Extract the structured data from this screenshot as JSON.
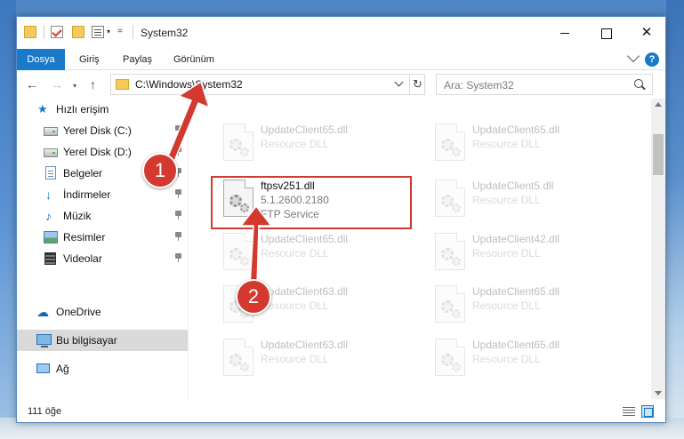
{
  "window": {
    "title": "System32",
    "quick_access": {
      "menu_glyph": "="
    },
    "controls": {
      "minimize": "",
      "maximize": "",
      "close": "✕"
    }
  },
  "ribbon": {
    "tabs": [
      {
        "label": "Dosya",
        "active": true
      },
      {
        "label": "Giriş"
      },
      {
        "label": "Paylaş"
      },
      {
        "label": "Görünüm"
      }
    ],
    "help_glyph": "?"
  },
  "navigation": {
    "back_glyph": "←",
    "forward_glyph": "→",
    "recent_glyph": "▾",
    "up_glyph": "↑",
    "refresh_glyph": "↻",
    "address": "C:\\Windows\\System32",
    "search_placeholder": "Ara: System32"
  },
  "sidebar": {
    "items": [
      {
        "label": "Hızlı erişim",
        "icon": "star-icon"
      },
      {
        "label": "Yerel Disk (C:)",
        "icon": "drive-icon",
        "pinned": true
      },
      {
        "label": "Yerel Disk (D:)",
        "icon": "drive-icon",
        "pinned": true
      },
      {
        "label": "Belgeler",
        "icon": "documents-icon",
        "pinned": true
      },
      {
        "label": "İndirmeler",
        "icon": "download-icon",
        "pinned": true
      },
      {
        "label": "Müzik",
        "icon": "music-icon",
        "pinned": true
      },
      {
        "label": "Resimler",
        "icon": "pictures-icon",
        "pinned": true
      },
      {
        "label": "Videolar",
        "icon": "videos-icon",
        "pinned": true
      },
      {
        "label": "OneDrive",
        "icon": "onedrive-icon"
      },
      {
        "label": "Bu bilgisayar",
        "icon": "computer-icon",
        "selected": true
      },
      {
        "label": "Ağ",
        "icon": "network-icon"
      }
    ]
  },
  "files": [
    {
      "name": "UpdateClient65.dll",
      "line2": "Resource DLL",
      "line3": ""
    },
    {
      "name": "UpdateClient65.dll",
      "line2": "Resource DLL",
      "line3": ""
    },
    {
      "name": "ftpsv251.dll",
      "line2": "5.1.2600.2180",
      "line3": "FTP Service",
      "highlighted": true
    },
    {
      "name": "UpdateClient5.dll",
      "line2": "Resource DLL",
      "line3": ""
    },
    {
      "name": "UpdateClient65.dll",
      "line2": "Resource DLL",
      "line3": ""
    },
    {
      "name": "UpdateClient42.dll",
      "line2": "Resource DLL",
      "line3": ""
    },
    {
      "name": "UpdateClient63.dll",
      "line2": "Resource DLL",
      "line3": ""
    },
    {
      "name": "UpdateClient65.dll",
      "line2": "Resource DLL",
      "line3": ""
    },
    {
      "name": "UpdateClient63.dll",
      "line2": "Resource DLL",
      "line3": ""
    },
    {
      "name": "UpdateClient65.dll",
      "line2": "Resource DLL",
      "line3": ""
    }
  ],
  "status": {
    "item_count": "111 öğe"
  },
  "annotations": {
    "step1": "1",
    "step2": "2",
    "color": "#d3392f"
  }
}
